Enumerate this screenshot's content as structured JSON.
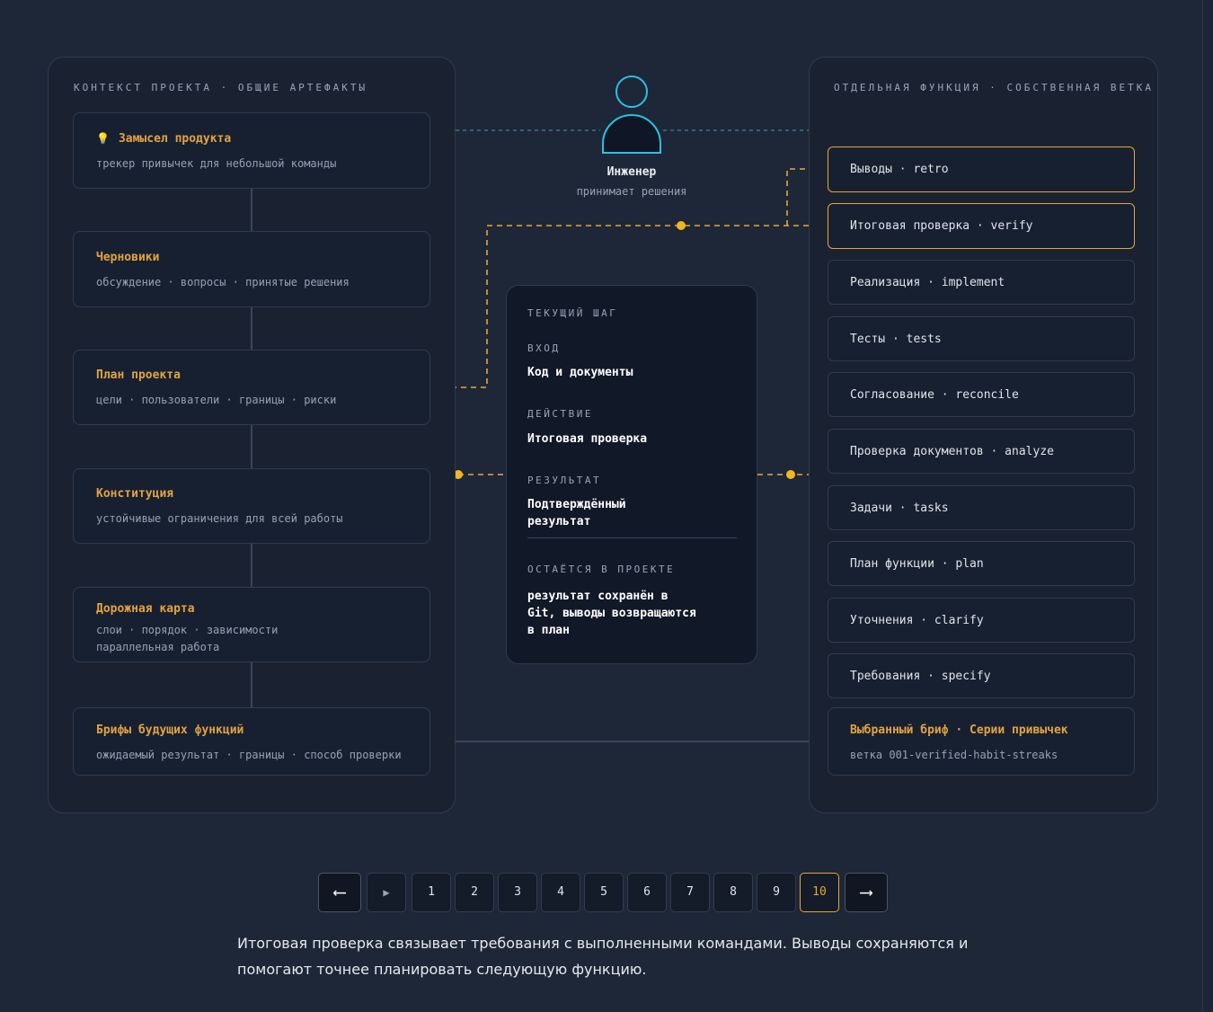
{
  "left_panel": {
    "heading": "КОНТЕКСТ ПРОЕКТА · ОБЩИЕ АРТЕФАКТЫ",
    "cards": [
      {
        "title": "Замысел продукта",
        "sub1": "трекер привычек для небольшой команды",
        "sub2": ""
      },
      {
        "title": "Черновики",
        "sub1": "обсуждение · вопросы · принятые решения",
        "sub2": ""
      },
      {
        "title": "План проекта",
        "sub1": "цели · пользователи · границы · риски",
        "sub2": ""
      },
      {
        "title": "Конституция",
        "sub1": "устойчивые ограничения для всей работы",
        "sub2": ""
      },
      {
        "title": "Дорожная карта",
        "sub1": "слои · порядок · зависимости",
        "sub2": "параллельная работа"
      },
      {
        "title": "Брифы будущих функций",
        "sub1": "ожидаемый результат · границы · способ проверки",
        "sub2": ""
      }
    ]
  },
  "engineer": {
    "title": "Инженер",
    "subtitle": "принимает решения"
  },
  "current_step": {
    "heading": "ТЕКУЩИЙ ШАГ",
    "input_label": "ВХОД",
    "input_value": "Код и документы",
    "action_label": "ДЕЙСТВИЕ",
    "action_value": "Итоговая проверка",
    "result_label": "РЕЗУЛЬТАТ",
    "result_value": "Подтверждённый результат",
    "stays_label": "ОСТАЁТСЯ В ПРОЕКТЕ",
    "stays_value": "результат сохранён в Git, выводы возвращаются в план"
  },
  "right_panel": {
    "heading": "ОТДЕЛЬНАЯ ФУНКЦИЯ · СОБСТВЕННАЯ ВЕТКА",
    "steps": [
      {
        "label": "Выводы · retro",
        "highlighted": true
      },
      {
        "label": "Итоговая проверка · verify",
        "highlighted": true
      },
      {
        "label": "Реализация · implement",
        "highlighted": false
      },
      {
        "label": "Тесты · tests",
        "highlighted": false
      },
      {
        "label": "Согласование · reconcile",
        "highlighted": false
      },
      {
        "label": "Проверка документов · analyze",
        "highlighted": false
      },
      {
        "label": "Задачи · tasks",
        "highlighted": false
      },
      {
        "label": "План функции · plan",
        "highlighted": false
      },
      {
        "label": "Уточнения · clarify",
        "highlighted": false
      },
      {
        "label": "Требования · specify",
        "highlighted": false
      }
    ],
    "brief": {
      "title": "Выбранный бриф · Серии привычек",
      "branch": "ветка 001-verified-habit-streaks"
    }
  },
  "pager": {
    "prev": "⟵",
    "play": "▶",
    "pages": [
      "1",
      "2",
      "3",
      "4",
      "5",
      "6",
      "7",
      "8",
      "9",
      "10"
    ],
    "active_page": "10",
    "next": "⟶"
  },
  "caption": "Итоговая проверка связывает требования с выполненными командами. Выводы сохраняются и помогают точнее планировать следующую функцию.",
  "colors": {
    "accent": "#e7a733",
    "background": "#1e2738",
    "panel": "#1a2232",
    "engineer_icon": "#2bc0e4"
  },
  "icons": {
    "idea": "lightbulb-icon",
    "engineer": "person-icon"
  }
}
